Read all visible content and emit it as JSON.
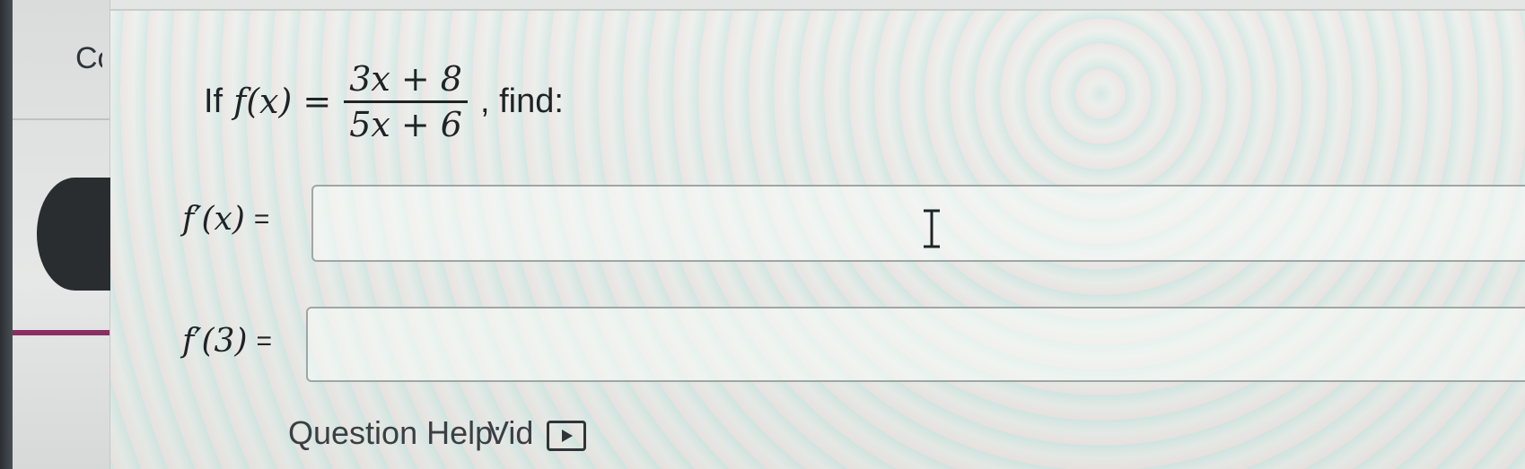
{
  "sidebar": {
    "heading": "Co"
  },
  "problem": {
    "prefix": "If",
    "function": "f(x) =",
    "numerator": "3x + 8",
    "denominator": "5x + 6",
    "suffix": ", find:"
  },
  "answers": [
    {
      "label": "f′(x)",
      "equals": "=",
      "value": ""
    },
    {
      "label": "f′(3)",
      "equals": "=",
      "value": ""
    }
  ],
  "footer": {
    "question_help": "Question Help:",
    "video_label": "Vid"
  },
  "colors": {
    "accent": "#8a2f63",
    "box_border": "#9ea6a6"
  }
}
